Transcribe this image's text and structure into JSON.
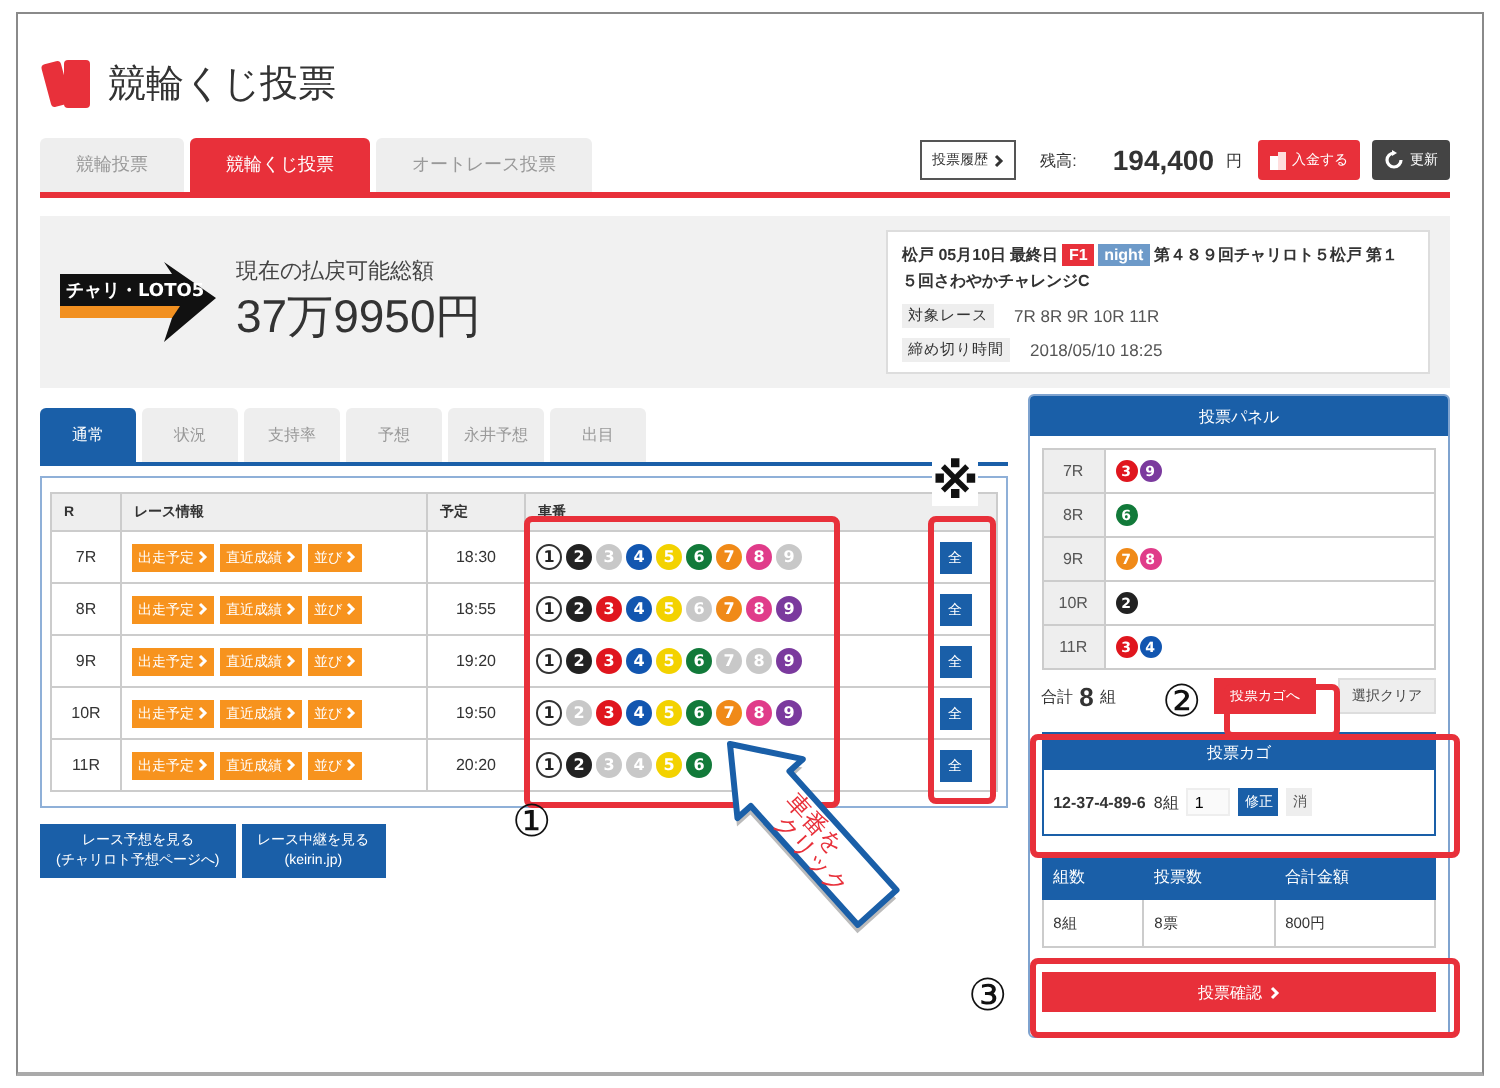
{
  "header": {
    "title": "競輪くじ投票"
  },
  "main_tabs": [
    {
      "label": "競輪投票",
      "selected": false
    },
    {
      "label": "競輪くじ投票",
      "selected": true
    },
    {
      "label": "オートレース投票",
      "selected": false
    }
  ],
  "account": {
    "history_button": "投票履歴",
    "balance_label": "残高:",
    "balance": "194,400",
    "currency": "円",
    "deposit_button": "入金する",
    "refresh_button": "更新"
  },
  "payout": {
    "logo_text": "チャリ・LOTO5",
    "label": "現在の払戻可能総額",
    "amount": "37万9950円"
  },
  "race_info": {
    "venue_line": "松戸 05月10日 最終日",
    "grade_badge": "F1",
    "night_badge": "night",
    "title": "第４８９回チャリロト５松戸 第１５回さわやかチャレンジC",
    "target_label": "対象レース",
    "target_races": "7R 8R 9R 10R 11R",
    "deadline_label": "締め切り時間",
    "deadline": "2018/05/10 18:25"
  },
  "sub_tabs": [
    {
      "label": "通常",
      "selected": true
    },
    {
      "label": "状況",
      "selected": false
    },
    {
      "label": "支持率",
      "selected": false
    },
    {
      "label": "予想",
      "selected": false
    },
    {
      "label": "永井予想",
      "selected": false
    },
    {
      "label": "出目",
      "selected": false
    }
  ],
  "race_table": {
    "columns": [
      "R",
      "レース情報",
      "予定",
      "車番"
    ],
    "rows": [
      {
        "race": "7R",
        "links": [
          "出走予定",
          "直近成績",
          "並び"
        ],
        "time": "18:30",
        "all_button": "全",
        "numbers": [
          {
            "label": "1",
            "selected": true,
            "color": "#ffffff"
          },
          {
            "label": "2",
            "selected": true,
            "color": "#222222"
          },
          {
            "label": "3",
            "selected": false
          },
          {
            "label": "4",
            "selected": true,
            "color": "#1256b0"
          },
          {
            "label": "5",
            "selected": true,
            "color": "#f3d200"
          },
          {
            "label": "6",
            "selected": true,
            "color": "#127a3a"
          },
          {
            "label": "7",
            "selected": true,
            "color": "#f08a18"
          },
          {
            "label": "8",
            "selected": true,
            "color": "#e03c8a"
          },
          {
            "label": "9",
            "selected": false
          }
        ]
      },
      {
        "race": "8R",
        "links": [
          "出走予定",
          "直近成績",
          "並び"
        ],
        "time": "18:55",
        "all_button": "全",
        "numbers": [
          {
            "label": "1",
            "selected": true,
            "color": "#ffffff"
          },
          {
            "label": "2",
            "selected": true,
            "color": "#222222"
          },
          {
            "label": "3",
            "selected": true,
            "color": "#e0161e"
          },
          {
            "label": "4",
            "selected": true,
            "color": "#1256b0"
          },
          {
            "label": "5",
            "selected": true,
            "color": "#f3d200"
          },
          {
            "label": "6",
            "selected": false
          },
          {
            "label": "7",
            "selected": true,
            "color": "#f08a18"
          },
          {
            "label": "8",
            "selected": true,
            "color": "#e03c8a"
          },
          {
            "label": "9",
            "selected": true,
            "color": "#7b3a9e"
          }
        ]
      },
      {
        "race": "9R",
        "links": [
          "出走予定",
          "直近成績",
          "並び"
        ],
        "time": "19:20",
        "all_button": "全",
        "numbers": [
          {
            "label": "1",
            "selected": true,
            "color": "#ffffff"
          },
          {
            "label": "2",
            "selected": true,
            "color": "#222222"
          },
          {
            "label": "3",
            "selected": true,
            "color": "#e0161e"
          },
          {
            "label": "4",
            "selected": true,
            "color": "#1256b0"
          },
          {
            "label": "5",
            "selected": true,
            "color": "#f3d200"
          },
          {
            "label": "6",
            "selected": true,
            "color": "#127a3a"
          },
          {
            "label": "7",
            "selected": false
          },
          {
            "label": "8",
            "selected": false
          },
          {
            "label": "9",
            "selected": true,
            "color": "#7b3a9e"
          }
        ]
      },
      {
        "race": "10R",
        "links": [
          "出走予定",
          "直近成績",
          "並び"
        ],
        "time": "19:50",
        "all_button": "全",
        "numbers": [
          {
            "label": "1",
            "selected": true,
            "color": "#ffffff"
          },
          {
            "label": "2",
            "selected": false
          },
          {
            "label": "3",
            "selected": true,
            "color": "#e0161e"
          },
          {
            "label": "4",
            "selected": true,
            "color": "#1256b0"
          },
          {
            "label": "5",
            "selected": true,
            "color": "#f3d200"
          },
          {
            "label": "6",
            "selected": true,
            "color": "#127a3a"
          },
          {
            "label": "7",
            "selected": true,
            "color": "#f08a18"
          },
          {
            "label": "8",
            "selected": true,
            "color": "#e03c8a"
          },
          {
            "label": "9",
            "selected": true,
            "color": "#7b3a9e"
          }
        ]
      },
      {
        "race": "11R",
        "links": [
          "出走予定",
          "直近成績",
          "並び"
        ],
        "time": "20:20",
        "all_button": "全",
        "numbers": [
          {
            "label": "1",
            "selected": true,
            "color": "#ffffff"
          },
          {
            "label": "2",
            "selected": true,
            "color": "#222222"
          },
          {
            "label": "3",
            "selected": false
          },
          {
            "label": "4",
            "selected": false
          },
          {
            "label": "5",
            "selected": true,
            "color": "#f3d200"
          },
          {
            "label": "6",
            "selected": true,
            "color": "#127a3a"
          }
        ]
      }
    ]
  },
  "link_buttons": [
    "レース予想を見る\n(チャリロト予想ページへ)",
    "レース中継を見る\n(keirin.jp)"
  ],
  "vote_panel": {
    "title": "投票パネル",
    "rows": [
      {
        "race": "7R",
        "numbers": [
          {
            "label": "3",
            "color": "#e0161e"
          },
          {
            "label": "9",
            "color": "#7b3a9e"
          }
        ]
      },
      {
        "race": "8R",
        "numbers": [
          {
            "label": "6",
            "color": "#127a3a"
          }
        ]
      },
      {
        "race": "9R",
        "numbers": [
          {
            "label": "7",
            "color": "#f08a18"
          },
          {
            "label": "8",
            "color": "#e03c8a"
          }
        ]
      },
      {
        "race": "10R",
        "numbers": [
          {
            "label": "2",
            "color": "#222222"
          }
        ]
      },
      {
        "race": "11R",
        "numbers": [
          {
            "label": "3",
            "color": "#e0161e"
          },
          {
            "label": "4",
            "color": "#1256b0"
          }
        ]
      }
    ],
    "total_label": "合計",
    "total_count": "8",
    "total_unit": "組",
    "cart_button": "投票カゴへ",
    "clear_button": "選択クリア"
  },
  "cart": {
    "title": "投票カゴ",
    "items": [
      {
        "combo": "12-37-4-89-6",
        "sets": "8組",
        "quantity": "1",
        "edit_button": "修正",
        "delete_button": "消"
      }
    ]
  },
  "summary": {
    "columns": [
      "組数",
      "投票数",
      "合計金額"
    ],
    "values": [
      "8組",
      "8票",
      "800円"
    ]
  },
  "confirm_button": "投票確認",
  "annotations": {
    "markers": [
      "①",
      "②",
      "③",
      "※"
    ],
    "callout_text": "車番を\nクリック"
  }
}
